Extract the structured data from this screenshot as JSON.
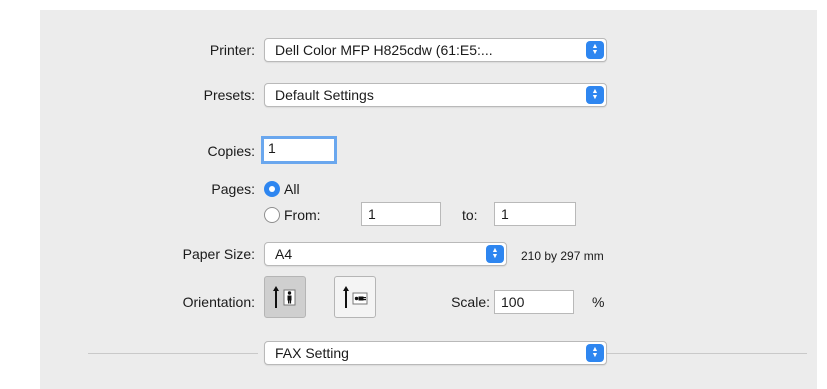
{
  "printer": {
    "label": "Printer:",
    "value": "Dell Color MFP H825cdw (61:E5:..."
  },
  "presets": {
    "label": "Presets:",
    "value": "Default Settings"
  },
  "copies": {
    "label": "Copies:",
    "value": "1"
  },
  "pages": {
    "label": "Pages:",
    "all_label": "All",
    "from_label": "From:",
    "from_value": "1",
    "to_label": "to:",
    "to_value": "1",
    "selected": "All"
  },
  "paper_size": {
    "label": "Paper Size:",
    "value": "A4",
    "dimensions": "210 by 297 mm"
  },
  "orientation": {
    "label": "Orientation:",
    "selected": "portrait"
  },
  "scale": {
    "label": "Scale:",
    "value": "100",
    "unit": "%"
  },
  "section_menu": {
    "value": "FAX Setting"
  },
  "colors": {
    "accent": "#2e86f0",
    "focus_ring": "#6aa7ee",
    "panel_bg": "#ececec"
  },
  "icons": [
    "popup-chevron-icon",
    "portrait-orientation-icon",
    "landscape-orientation-icon"
  ]
}
